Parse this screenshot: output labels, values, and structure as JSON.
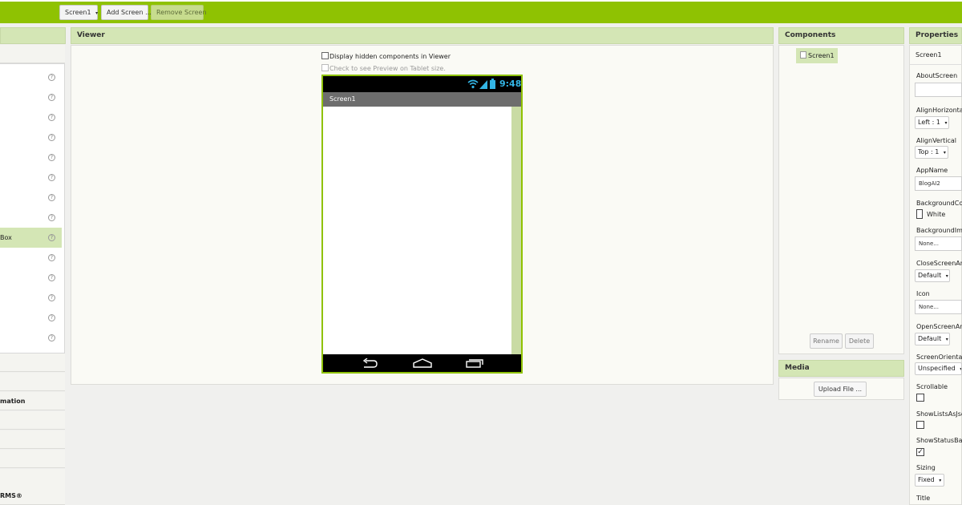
{
  "toolbar": {
    "screen_select": "Screen1",
    "add_screen": "Add Screen ...",
    "remove_screen": "Remove Screen"
  },
  "palette": {
    "selected_item_label": "Box",
    "help_glyph": "?",
    "categories": [
      "mation",
      "RMS®"
    ]
  },
  "viewer": {
    "title": "Viewer",
    "hidden_components_label": "Display hidden components in Viewer",
    "tablet_preview_label": "Check to see Preview on Tablet size.",
    "phone": {
      "clock": "9:48",
      "screen_title": "Screen1"
    }
  },
  "components": {
    "title": "Components",
    "tree_item": "Screen1",
    "rename": "Rename",
    "delete": "Delete"
  },
  "media": {
    "title": "Media",
    "upload": "Upload File ..."
  },
  "properties": {
    "title": "Properties",
    "component_name": "Screen1",
    "about_screen": "AboutScreen",
    "align_horizontal": "AlignHorizontal",
    "align_horizontal_value": "Left : 1",
    "align_vertical": "AlignVertical",
    "align_vertical_value": "Top : 1",
    "app_name": "AppName",
    "app_name_value": "BlogAI2",
    "background_color": "BackgroundColor",
    "background_color_value": "White",
    "background_image": "BackgroundImage",
    "background_image_value": "None...",
    "close_screen_animation": "CloseScreenAnimation",
    "close_screen_animation_value": "Default",
    "icon": "Icon",
    "icon_value": "None...",
    "open_screen_animation": "OpenScreenAnimation",
    "open_screen_animation_value": "Default",
    "screen_orientation": "ScreenOrientation",
    "screen_orientation_value": "Unspecified",
    "scrollable": "Scrollable",
    "show_lists_as_json": "ShowListsAsJson",
    "show_status_bar": "ShowStatusBar",
    "sizing": "Sizing",
    "sizing_value": "Fixed",
    "title_label": "Title",
    "checkmark": "✓",
    "dropdown_arrow": "▾"
  }
}
